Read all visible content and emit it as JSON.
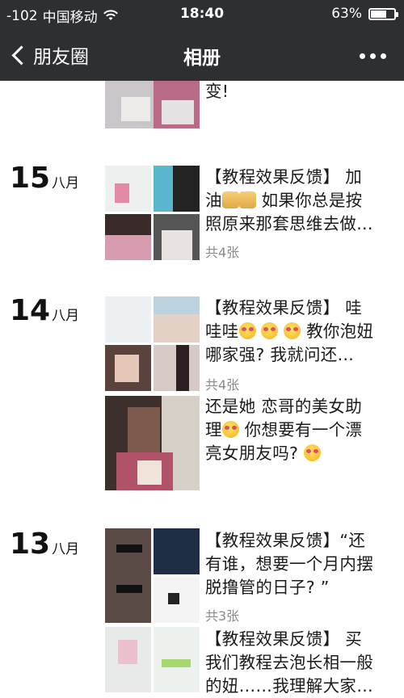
{
  "status_bar": {
    "signal": "-102",
    "carrier": "中国移动",
    "wifi_icon": "wifi-icon",
    "time": "18:40",
    "battery": "63%"
  },
  "nav": {
    "back_label": "朋友圈",
    "title": "相册",
    "more_icon": "more-dots-icon"
  },
  "posts": [
    {
      "id": "top",
      "text": "变!"
    },
    {
      "id": "p15",
      "day": "15",
      "month": "八月",
      "text_a": "【教程效果反馈】 加",
      "text_b": "油",
      "text_c": " 如果你总是按",
      "text_d": "照原来那套思维去做...",
      "count": "共4张"
    },
    {
      "id": "p14a",
      "day": "14",
      "month": "八月",
      "text_a": "【教程效果反馈】 哇",
      "text_b": "哇哇",
      "text_c": " 教你泡妞",
      "text_d": "哪家强? 我就问还...",
      "count": "共4张"
    },
    {
      "id": "p14b",
      "text_a": "还是她 恋哥的美女助",
      "text_b": "理",
      "text_c": " 你想要有一个漂",
      "text_d": "亮女朋友吗?"
    },
    {
      "id": "p13a",
      "day": "13",
      "month": "八月",
      "text_a": "【教程效果反馈】“还",
      "text_b": "有谁，想要一个月内摆",
      "text_c": "脱撸管的日子? ”",
      "count": "共3张"
    },
    {
      "id": "p13b",
      "text_a": "【教程效果反馈】 买",
      "text_b": "我们教程去泡长相一般",
      "text_c": "的妞……我理解大家…"
    }
  ]
}
